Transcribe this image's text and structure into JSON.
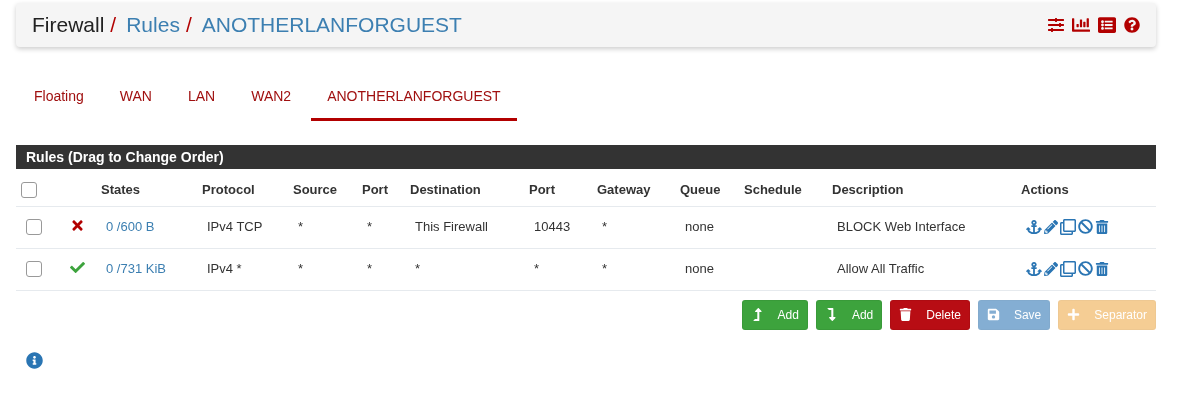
{
  "breadcrumb": [
    {
      "label": "Firewall",
      "link": false,
      "separator": "/"
    },
    {
      "label": "Rules",
      "link": true,
      "separator": "/"
    },
    {
      "label": "ANOTHERLANFORGUEST",
      "link": true
    }
  ],
  "tabs": [
    {
      "label": "Floating",
      "selected": false
    },
    {
      "label": "WAN",
      "selected": false
    },
    {
      "label": "LAN",
      "selected": false
    },
    {
      "label": "WAN2",
      "selected": false
    },
    {
      "label": "ANOTHERLANFORGUEST",
      "selected": true
    }
  ],
  "panel": {
    "title": "Rules (Drag to Change Order)"
  },
  "table": {
    "select_all_checked": false,
    "columns": [
      "States",
      "Protocol",
      "Source",
      "Port",
      "Destination",
      "Port",
      "Gateway",
      "Queue",
      "Schedule",
      "Description",
      "Actions"
    ],
    "rows": [
      {
        "checked": false,
        "kind": "block",
        "states": "0 /600 B",
        "protocol": "IPv4 TCP",
        "source": "*",
        "source_port": "*",
        "destination": "This Firewall",
        "destination_port": "10443",
        "gateway": "*",
        "queue": "none",
        "description": "BLOCK Web Interface"
      },
      {
        "checked": false,
        "kind": "pass",
        "states": "0 /731 KiB",
        "protocol": "IPv4 *",
        "source": "*",
        "source_port": "*",
        "destination": "*",
        "destination_port": "*",
        "gateway": "*",
        "queue": "none",
        "description": "Allow All Traffic"
      }
    ]
  },
  "buttons": [
    {
      "kind": "add-top",
      "label": "Add",
      "disabled": false
    },
    {
      "kind": "add-bottom",
      "label": "Add",
      "disabled": false
    },
    {
      "kind": "delete",
      "label": "Delete",
      "disabled": false
    },
    {
      "kind": "save",
      "label": "Save",
      "disabled": true
    },
    {
      "kind": "separator",
      "label": "Separator",
      "disabled": true
    }
  ]
}
